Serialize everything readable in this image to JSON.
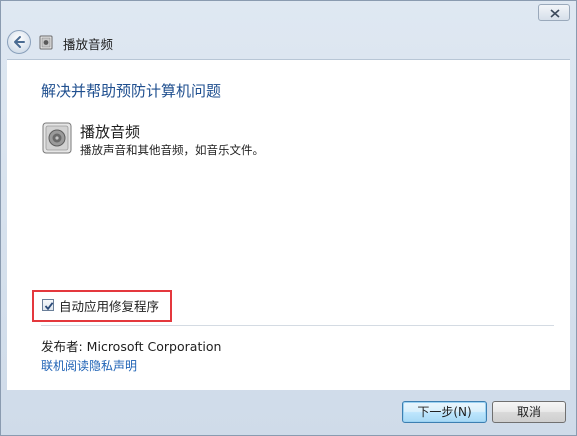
{
  "window": {
    "nav_title": "播放音频",
    "close_icon": "close-icon",
    "back_icon": "back-arrow-icon"
  },
  "main": {
    "heading": "解决并帮助预防计算机问题",
    "item": {
      "title": "播放音频",
      "description": "播放声音和其他音频，如音乐文件。",
      "icon": "speaker-icon"
    },
    "auto_fix": {
      "label": "自动应用修复程序",
      "checked": true
    },
    "publisher": "发布者: Microsoft Corporation",
    "privacy_link": "联机阅读隐私声明"
  },
  "buttons": {
    "next": "下一步(N)",
    "cancel": "取消"
  },
  "colors": {
    "heading": "#1f4f8f",
    "link": "#1e62b5",
    "highlight": "#e4383d"
  }
}
